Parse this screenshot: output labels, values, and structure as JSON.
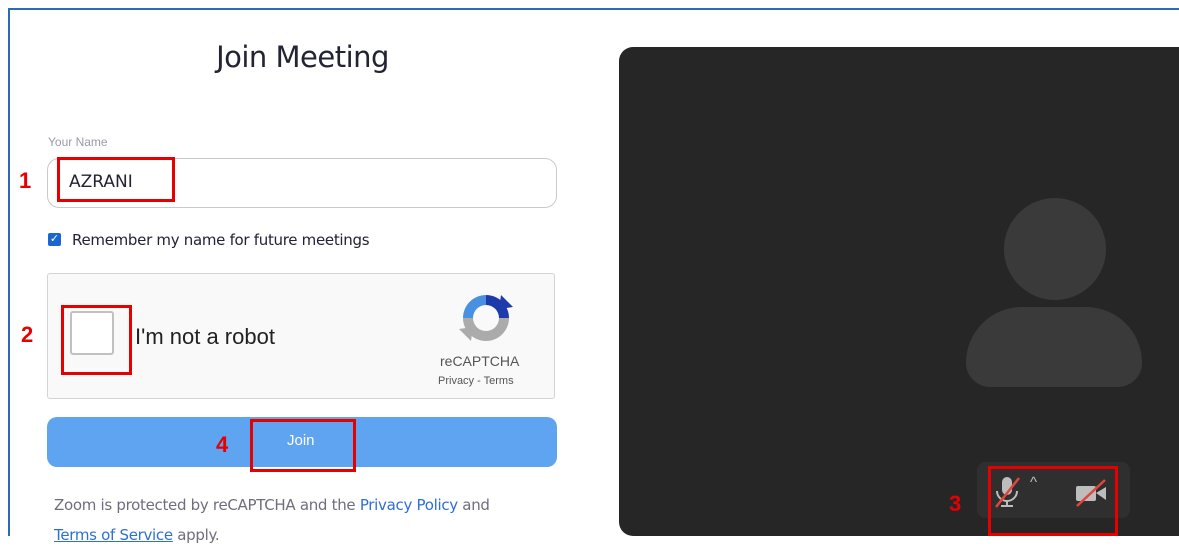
{
  "title": "Join Meeting",
  "name_field": {
    "label": "Your Name",
    "value": "AZRANI"
  },
  "remember": {
    "checked": true,
    "label": "Remember my name for future meetings"
  },
  "captcha": {
    "label": "I'm not a robot",
    "brand": "reCAPTCHA",
    "privacy": "Privacy",
    "separator": " - ",
    "terms": "Terms"
  },
  "join_button": {
    "label": "Join"
  },
  "disclaimer": {
    "prefix": "Zoom is protected by reCAPTCHA and the ",
    "privacy_link": "Privacy Policy",
    "middle": " and",
    "terms_link": "Terms of Service",
    "suffix": " apply."
  },
  "preview": {
    "mic_state": "muted",
    "video_state": "off",
    "icons": [
      "mic-muted-icon",
      "caret-up-icon",
      "video-off-icon",
      "avatar-placeholder-icon"
    ]
  },
  "annotations": [
    "1",
    "2",
    "3",
    "4"
  ],
  "colors": {
    "accent": "#1a66d0",
    "join_button": "#5fa4f0",
    "preview_bg": "#262626",
    "annotation": "#e60000",
    "muted_slash": "#e0463c"
  }
}
